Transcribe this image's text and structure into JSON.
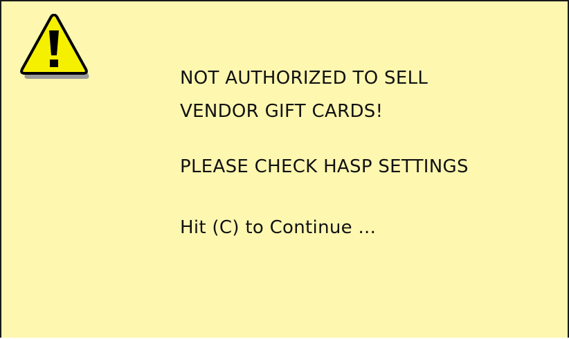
{
  "dialog": {
    "icon": "warning-triangle-icon",
    "message_line1": "NOT AUTHORIZED TO SELL",
    "message_line2": "VENDOR GIFT CARDS!",
    "message_line3": "PLEASE CHECK HASP SETTINGS",
    "prompt": "Hit (C) to Continue ..."
  },
  "colors": {
    "background": "#fdf7b0",
    "icon_fill": "#f5f000",
    "text": "#111111"
  }
}
